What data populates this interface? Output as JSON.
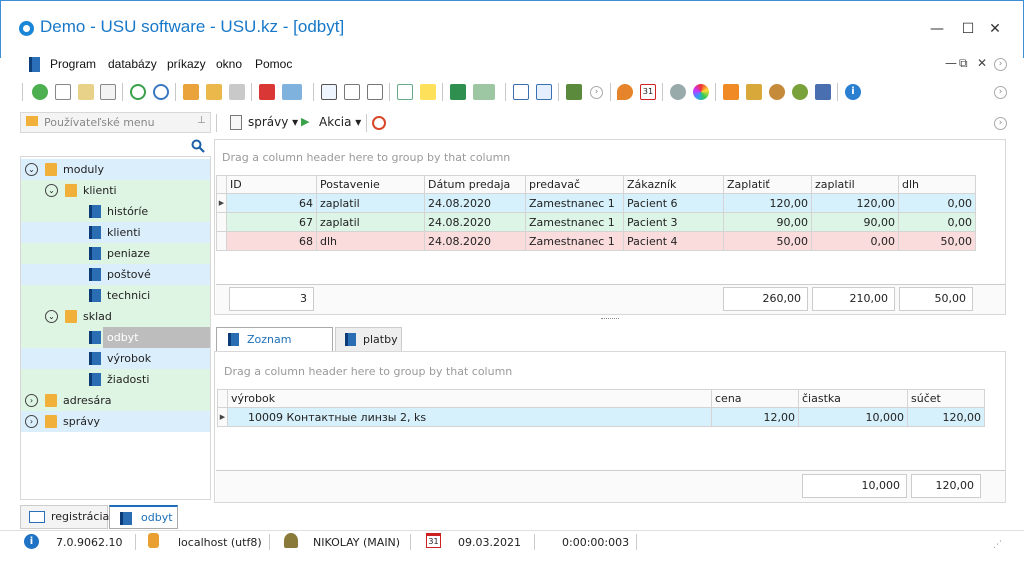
{
  "window": {
    "title": "Demo - USU software - USU.kz - [odbyt]",
    "controls": [
      "—",
      "☐",
      "✕"
    ]
  },
  "menu": {
    "items": [
      "Program",
      "databázy",
      "príkazy",
      "okno",
      "Pomoc"
    ],
    "mdi_controls": [
      "—",
      "⧉",
      "✕"
    ]
  },
  "left_panel": {
    "title": "Používateľské menu",
    "tree": [
      {
        "label": "moduly",
        "level": 0,
        "expander": "⌄",
        "type": "folder"
      },
      {
        "label": "klienti",
        "level": 1,
        "expander": "⌄",
        "type": "folder"
      },
      {
        "label": "históríe",
        "level": 2,
        "type": "book"
      },
      {
        "label": "klienti",
        "level": 2,
        "type": "book"
      },
      {
        "label": "peniaze",
        "level": 2,
        "type": "book"
      },
      {
        "label": "poštové",
        "level": 2,
        "type": "book"
      },
      {
        "label": "technici",
        "level": 2,
        "type": "book"
      },
      {
        "label": "sklad",
        "level": 1,
        "expander": "⌄",
        "type": "folder"
      },
      {
        "label": "odbyt",
        "level": 2,
        "type": "book",
        "selected": true
      },
      {
        "label": "výrobok",
        "level": 2,
        "type": "book"
      },
      {
        "label": "žiadosti",
        "level": 2,
        "type": "book"
      },
      {
        "label": "adresára",
        "level": 0,
        "expander": "›",
        "type": "folder"
      },
      {
        "label": "správy",
        "level": 0,
        "expander": "›",
        "type": "folder"
      }
    ]
  },
  "nav_tabs": [
    "registrácia",
    "odbyt"
  ],
  "right_toolbar": {
    "reports_label": "správy",
    "action_label": "Akcia"
  },
  "main_grid": {
    "group_hint": "Drag a column header here to group by that column",
    "columns": [
      "ID",
      "Postavenie",
      "Dátum predaja",
      "predavač",
      "Zákazník",
      "Zaplatiť",
      "zaplatil",
      "dlh"
    ],
    "rows": [
      [
        "64",
        "zaplatil",
        "24.08.2020",
        "Zamestnanec 1",
        "Pacient 6",
        "120,00",
        "120,00",
        "0,00"
      ],
      [
        "67",
        "zaplatil",
        "24.08.2020",
        "Zamestnanec 1",
        "Pacient 3",
        "90,00",
        "90,00",
        "0,00"
      ],
      [
        "68",
        "dlh",
        "24.08.2020",
        "Zamestnanec 1",
        "Pacient 4",
        "50,00",
        "0,00",
        "50,00"
      ]
    ],
    "footer": {
      "count": "3",
      "to_pay": "260,00",
      "paid": "210,00",
      "debt": "50,00"
    }
  },
  "detail_tabs": [
    "Zoznam predaja",
    "platby"
  ],
  "detail_grid": {
    "group_hint": "Drag a column header here to group by that column",
    "columns": [
      "výrobok",
      "cena",
      "čiastka",
      "súčet"
    ],
    "rows": [
      [
        "10009 Контактные линзы 2, ks",
        "12,00",
        "10,000",
        "120,00"
      ]
    ],
    "footer": {
      "quantity": "10,000",
      "sum": "120,00"
    }
  },
  "status_bar": {
    "version": "7.0.9062.10",
    "server": "localhost (utf8)",
    "user": "NIKOLAY (MAIN)",
    "date": "09.03.2021",
    "timer": "0:00:00:003",
    "calendar_day": "31"
  },
  "colors": {
    "accent": "#1878c8",
    "selected_row": "#d6f1fb",
    "paid_row": "#dcf5e6",
    "debt_row": "#fbdcdc",
    "tree_green": "#dff5e4",
    "tree_blue": "#dbeefb"
  }
}
